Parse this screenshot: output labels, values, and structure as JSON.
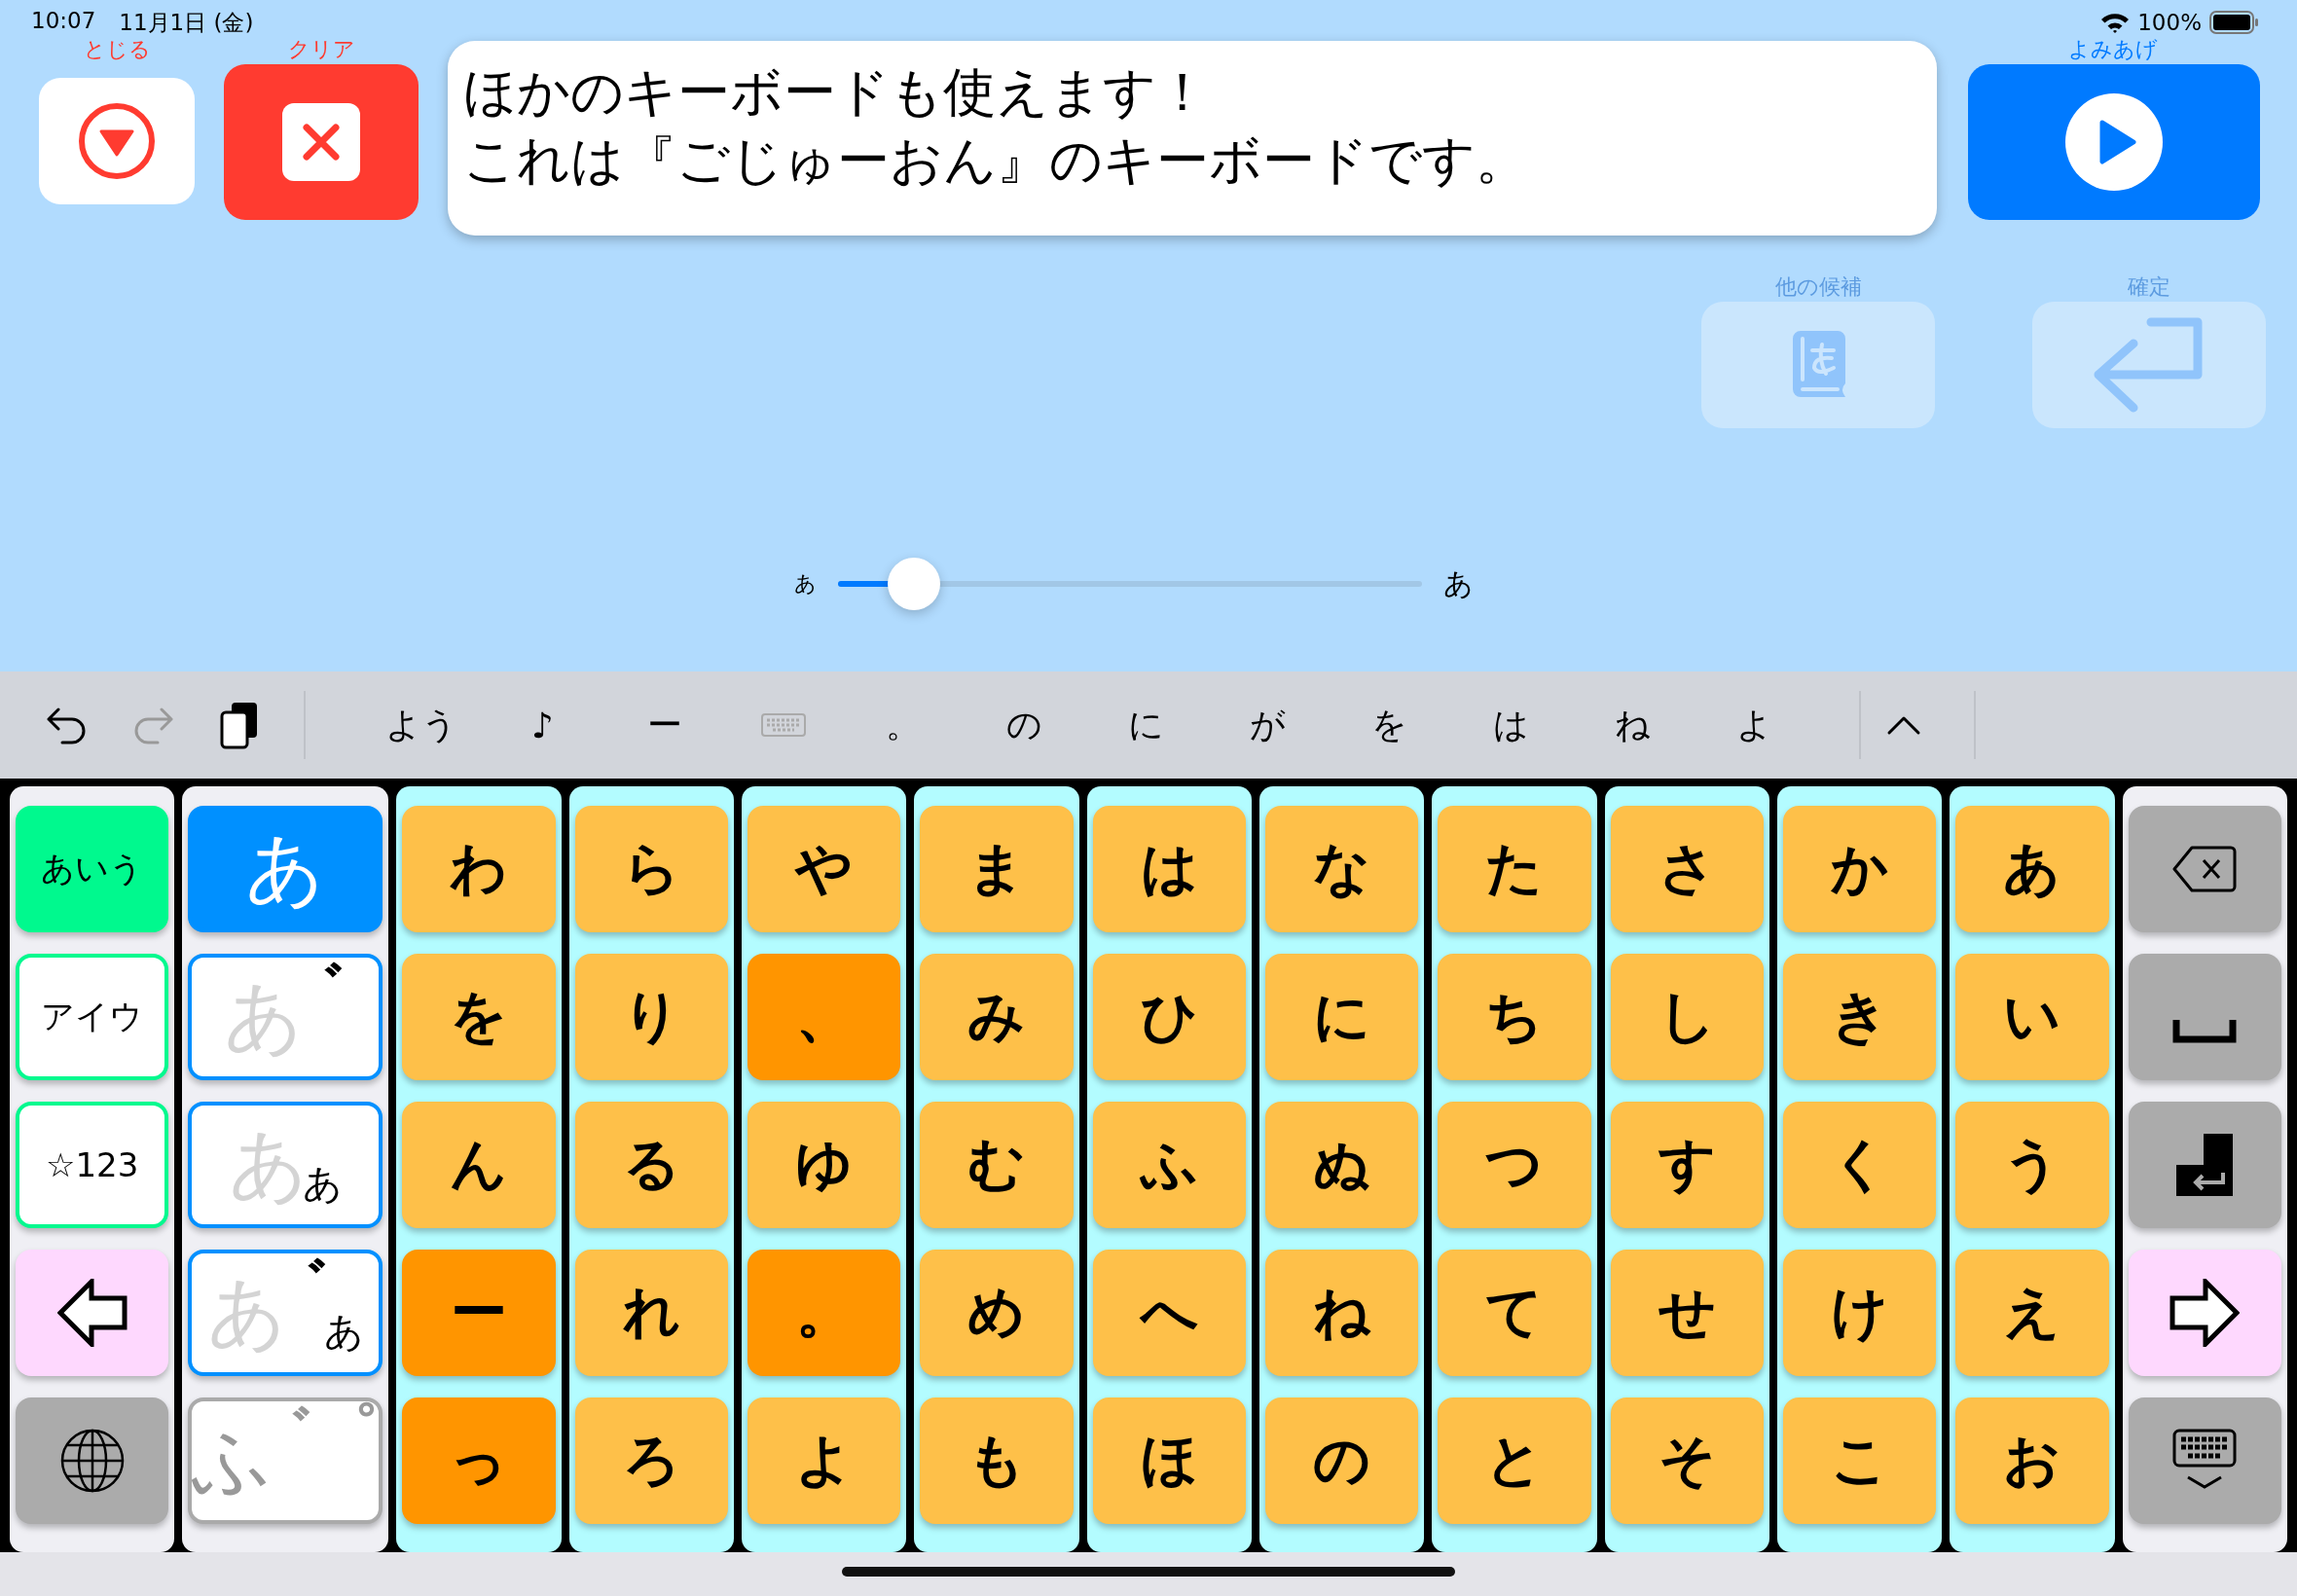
{
  "status_bar": {
    "time": "10:07",
    "date": "11月1日 (金)",
    "battery": "100%"
  },
  "close_button": {
    "label": "とじる"
  },
  "clear_button": {
    "label": "クリア"
  },
  "message": {
    "lines": [
      "ほかのキーボードも使えます！",
      "これは『ごじゅーおん』のキーボードです。"
    ]
  },
  "read_aloud_button": {
    "label": "よみあげ"
  },
  "candidates_button": {
    "label": "他の候補",
    "disabled": true
  },
  "confirm_button": {
    "label": "確定",
    "disabled": true
  },
  "font_size_slider": {
    "min_label": "あ",
    "max_label": "あ",
    "level": 0.13
  },
  "toolbar": {
    "suggestions": [
      {
        "kind": "text",
        "label": "よう"
      },
      {
        "kind": "text",
        "label": "♪"
      },
      {
        "kind": "text",
        "label": "ー"
      },
      {
        "kind": "keyboard"
      },
      {
        "kind": "text",
        "label": "。"
      },
      {
        "kind": "text",
        "label": "の"
      },
      {
        "kind": "text",
        "label": "に"
      },
      {
        "kind": "text",
        "label": "が"
      },
      {
        "kind": "text",
        "label": "を"
      },
      {
        "kind": "text",
        "label": "は"
      },
      {
        "kind": "text",
        "label": "ね"
      },
      {
        "kind": "text",
        "label": "よ"
      }
    ]
  },
  "keyboard": {
    "left_keys": [
      {
        "kind": "mode",
        "label": "あいう",
        "selected": true
      },
      {
        "kind": "mode",
        "label": "アイウ",
        "selected": false
      },
      {
        "kind": "mode",
        "label": "☆123",
        "selected": false
      },
      {
        "kind": "arrow-left"
      },
      {
        "kind": "globe"
      }
    ],
    "modifier_keys": [
      {
        "kind": "type",
        "main": "あ",
        "selected": true
      },
      {
        "kind": "type",
        "main": "あ",
        "accent": "゛",
        "selected": false
      },
      {
        "kind": "type",
        "main": "あ",
        "small": "あ",
        "selected": false
      },
      {
        "kind": "type",
        "main": "あ",
        "accent": "゛",
        "small": "あ",
        "selected": false
      },
      {
        "kind": "mark",
        "main": "ふ",
        "accent": "゛゜",
        "selected": false
      }
    ],
    "kana_columns": [
      {
        "keys": [
          {
            "kind": "kana",
            "label": "わ"
          },
          {
            "kind": "kana",
            "label": "を"
          },
          {
            "kind": "kana",
            "label": "ん"
          },
          {
            "kind": "symbol",
            "label": "ー"
          },
          {
            "kind": "symbol",
            "label": "っ"
          }
        ]
      },
      {
        "keys": [
          {
            "kind": "kana",
            "label": "ら"
          },
          {
            "kind": "kana",
            "label": "り"
          },
          {
            "kind": "kana",
            "label": "る"
          },
          {
            "kind": "kana",
            "label": "れ"
          },
          {
            "kind": "kana",
            "label": "ろ"
          }
        ]
      },
      {
        "keys": [
          {
            "kind": "kana",
            "label": "や"
          },
          {
            "kind": "symbol",
            "label": "、"
          },
          {
            "kind": "kana",
            "label": "ゆ"
          },
          {
            "kind": "symbol",
            "label": "。"
          },
          {
            "kind": "kana",
            "label": "よ"
          }
        ]
      },
      {
        "keys": [
          {
            "kind": "kana",
            "label": "ま"
          },
          {
            "kind": "kana",
            "label": "み"
          },
          {
            "kind": "kana",
            "label": "む"
          },
          {
            "kind": "kana",
            "label": "め"
          },
          {
            "kind": "kana",
            "label": "も"
          }
        ]
      },
      {
        "keys": [
          {
            "kind": "kana",
            "label": "は"
          },
          {
            "kind": "kana",
            "label": "ひ"
          },
          {
            "kind": "kana",
            "label": "ふ"
          },
          {
            "kind": "kana",
            "label": "へ"
          },
          {
            "kind": "kana",
            "label": "ほ"
          }
        ]
      },
      {
        "keys": [
          {
            "kind": "kana",
            "label": "な"
          },
          {
            "kind": "kana",
            "label": "に"
          },
          {
            "kind": "kana",
            "label": "ぬ"
          },
          {
            "kind": "kana",
            "label": "ね"
          },
          {
            "kind": "kana",
            "label": "の"
          }
        ]
      },
      {
        "keys": [
          {
            "kind": "kana",
            "label": "た"
          },
          {
            "kind": "kana",
            "label": "ち"
          },
          {
            "kind": "kana",
            "label": "つ"
          },
          {
            "kind": "kana",
            "label": "て"
          },
          {
            "kind": "kana",
            "label": "と"
          }
        ]
      },
      {
        "keys": [
          {
            "kind": "kana",
            "label": "さ"
          },
          {
            "kind": "kana",
            "label": "し"
          },
          {
            "kind": "kana",
            "label": "す"
          },
          {
            "kind": "kana",
            "label": "せ"
          },
          {
            "kind": "kana",
            "label": "そ"
          }
        ]
      },
      {
        "keys": [
          {
            "kind": "kana",
            "label": "か"
          },
          {
            "kind": "kana",
            "label": "き"
          },
          {
            "kind": "kana",
            "label": "く"
          },
          {
            "kind": "kana",
            "label": "け"
          },
          {
            "kind": "kana",
            "label": "こ"
          }
        ]
      },
      {
        "keys": [
          {
            "kind": "kana",
            "label": "あ"
          },
          {
            "kind": "kana",
            "label": "い"
          },
          {
            "kind": "kana",
            "label": "う"
          },
          {
            "kind": "kana",
            "label": "え"
          },
          {
            "kind": "kana",
            "label": "お"
          }
        ]
      }
    ],
    "right_keys": [
      {
        "kind": "backspace"
      },
      {
        "kind": "space"
      },
      {
        "kind": "enter"
      },
      {
        "kind": "arrow-right"
      },
      {
        "kind": "hide-keyboard"
      }
    ]
  }
}
